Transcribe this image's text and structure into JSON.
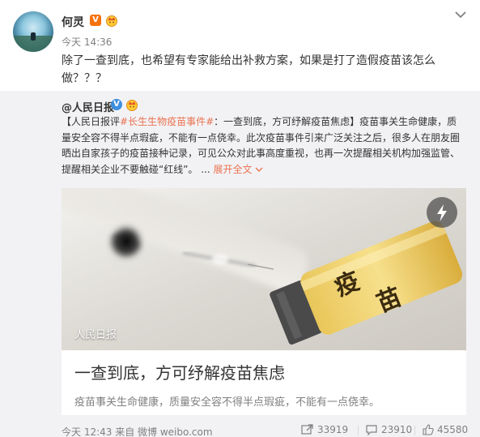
{
  "post": {
    "author": "何灵",
    "time": "今天 14:36",
    "text": "除了一查到底，也希望有专家能给出补救方案，如果是打了造假疫苗该怎么做？？？",
    "icons": [
      "avatar",
      "vip-badge",
      "crown-badge",
      "chevron-down-icon"
    ]
  },
  "repost": {
    "author": "@人民日报",
    "text_prefix": "【人民日报评",
    "hashtag": "#长生生物疫苗事件#",
    "text_body": "：一查到底，方可纾解疫苗焦虑】疫苗事关生命健康，质量安全容不得半点瑕疵，不能有一点侥幸。此次疫苗事件引来广泛关注之后，很多人在朋友圈晒出自家孩子的疫苗接种记录，可见公众对此事高度重视，也再一次提醒相关机构加强监管、提醒相关企业不要触碰“红线”。 ...",
    "expand_label": "展开全文",
    "card": {
      "image_caption": "人民日报",
      "title": "一查到底，方可纾解疫苗焦虑",
      "description": "疫苗事关生命健康，质量安全容不得半点瑕疵，不能有一点侥幸。",
      "vial_label": "疫苗"
    },
    "footer": {
      "time_source": "今天 12:43 来自 微博 weibo.com",
      "reposts": "33919",
      "comments": "23910",
      "likes": "45580"
    }
  },
  "colors": {
    "accent": "#eb7350",
    "verified_blue": "#3f8fe0",
    "vip_orange": "#f4730f",
    "repost_bg": "#f2f2f5"
  }
}
